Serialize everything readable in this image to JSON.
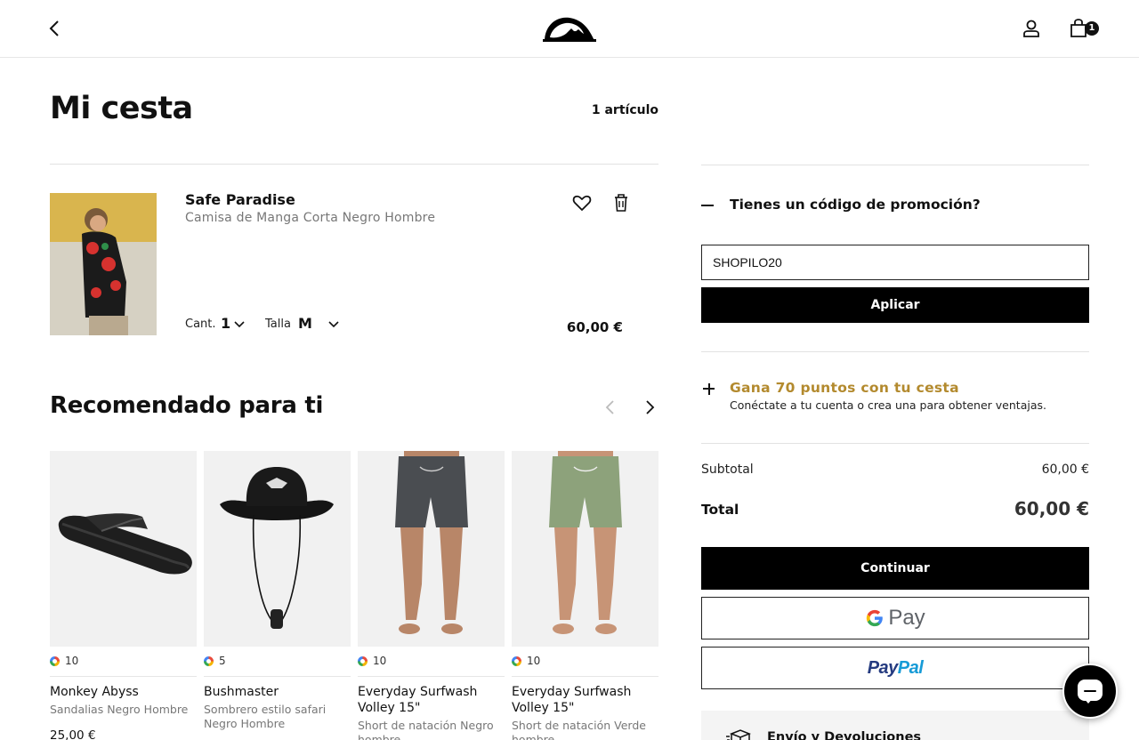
{
  "header": {
    "back_icon": "chevron-left-icon",
    "logo": "quiksilver-logo",
    "user_icon": "user-icon",
    "cart_icon": "shopping-bag-icon",
    "cart_count": "1"
  },
  "cart": {
    "title": "Mi cesta",
    "item_count": "1 artículo",
    "items": [
      {
        "name": "Safe Paradise",
        "description": "Camisa de Manga Corta Negro Hombre",
        "quantity_label": "Cant.",
        "quantity": "1",
        "size_label": "Talla",
        "size": "M",
        "price": "60,00 €"
      }
    ]
  },
  "recommended": {
    "title": "Recomendado para ti",
    "items": [
      {
        "points": "10",
        "name": "Monkey Abyss",
        "subtitle": "Sandalias Negro Hombre",
        "price": "25,00 €"
      },
      {
        "points": "5",
        "name": "Bushmaster",
        "subtitle": "Sombrero estilo safari Negro Hombre"
      },
      {
        "points": "10",
        "name": "Everyday Surfwash Volley 15\"",
        "subtitle": "Short de natación Negro hombre"
      },
      {
        "points": "10",
        "name": "Everyday Surfwash Volley 15\"",
        "subtitle": "Short de natación Verde hombre"
      }
    ]
  },
  "summary": {
    "promo_title": "Tienes un código de promoción?",
    "promo_code_value": "SHOPILO20",
    "apply_label": "Aplicar",
    "points_title": "Gana 70 puntos con tu cesta",
    "points_subtitle": "Conéctate a tu cuenta o crea una para obtener ventajas.",
    "subtotal_label": "Subtotal",
    "subtotal_value": "60,00 €",
    "total_label": "Total",
    "total_value": "60,00 €",
    "continue_label": "Continuar",
    "gpay_label": "Pay",
    "paypal_a": "Pay",
    "paypal_b": "Pal",
    "shipping_title": "Envío y Devoluciones"
  },
  "colors": {
    "accent_gold": "#b38a2e",
    "primary_black": "#000000"
  }
}
